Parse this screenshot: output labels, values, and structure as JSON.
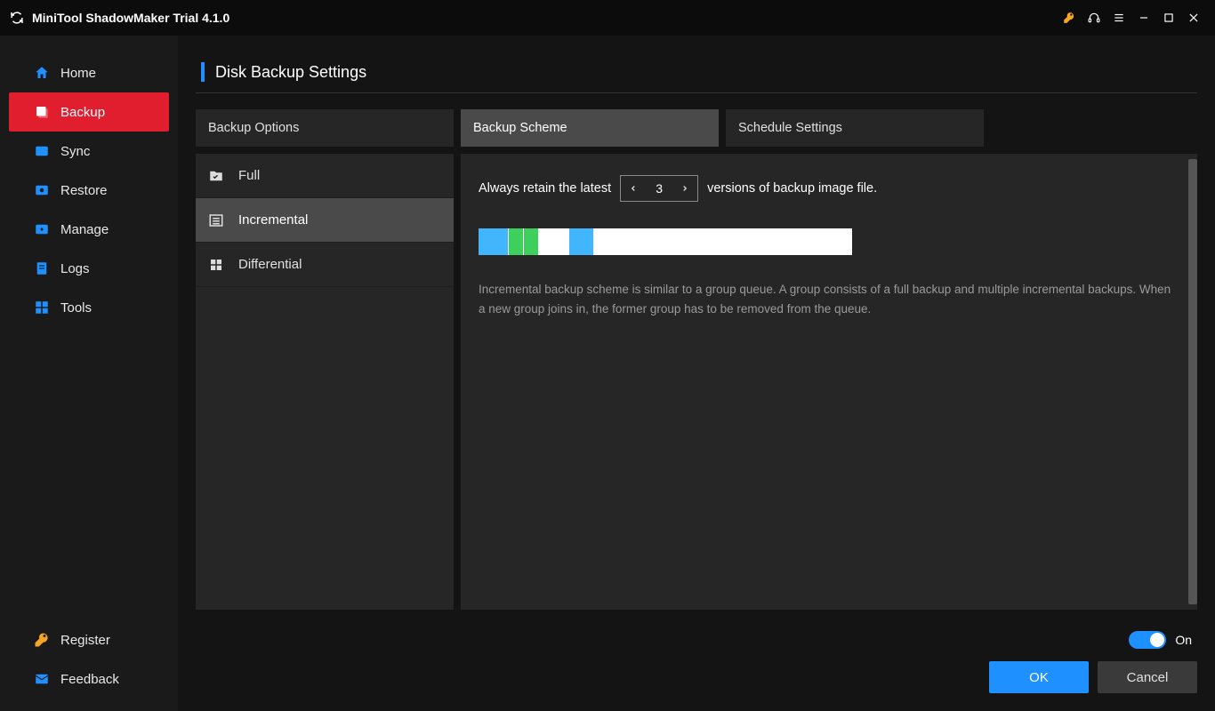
{
  "titlebar": {
    "title": "MiniTool ShadowMaker Trial 4.1.0"
  },
  "sidebar": {
    "items": [
      {
        "label": "Home"
      },
      {
        "label": "Backup"
      },
      {
        "label": "Sync"
      },
      {
        "label": "Restore"
      },
      {
        "label": "Manage"
      },
      {
        "label": "Logs"
      },
      {
        "label": "Tools"
      }
    ],
    "footer": [
      {
        "label": "Register"
      },
      {
        "label": "Feedback"
      }
    ]
  },
  "page": {
    "title": "Disk Backup Settings"
  },
  "tabs": [
    {
      "label": "Backup Options"
    },
    {
      "label": "Backup Scheme"
    },
    {
      "label": "Schedule Settings"
    }
  ],
  "modes": [
    {
      "label": "Full"
    },
    {
      "label": "Incremental"
    },
    {
      "label": "Differential"
    }
  ],
  "retain": {
    "prefix": "Always retain the latest",
    "value": "3",
    "suffix": "versions of backup image file."
  },
  "description": "Incremental backup scheme is similar to a group queue. A group consists of a full backup and multiple incremental backups. When a new group joins in, the former group has to be removed from the queue.",
  "toggle": {
    "label": "On"
  },
  "buttons": {
    "ok": "OK",
    "cancel": "Cancel"
  }
}
